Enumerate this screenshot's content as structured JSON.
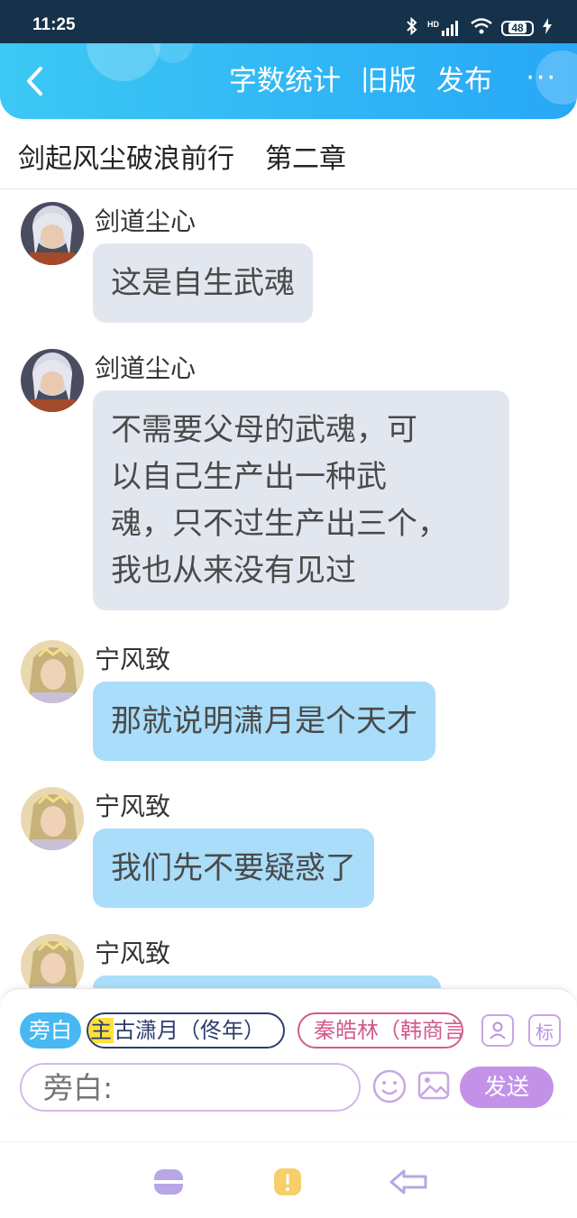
{
  "status_bar": {
    "time": "11:25",
    "battery": "48",
    "signal_label": "HD"
  },
  "header": {
    "actions": [
      "字数统计",
      "旧版",
      "发布"
    ],
    "more_label": "···",
    "colors": {
      "gradient_start": "#3cc8f4",
      "gradient_end": "#28a8f6"
    }
  },
  "title_bar": {
    "book_title": "剑起风尘破浪前行",
    "chapter": "第二章"
  },
  "messages": [
    {
      "name": "剑道尘心",
      "text": "这是自生武魂",
      "avatar": "silver-haired-avatar",
      "bubble": "grey"
    },
    {
      "name": "剑道尘心",
      "text": "不需要父母的武魂，可\n以自己生产出一种武\n魂，只不过生产出三个，\n我也从来没有见过",
      "avatar": "silver-haired-avatar",
      "bubble": "grey"
    },
    {
      "name": "宁风致",
      "text": "那就说明潇月是个天才",
      "avatar": "crowned-avatar",
      "bubble": "blue"
    },
    {
      "name": "宁风致",
      "text": "我们先不要疑惑了",
      "avatar": "crowned-avatar",
      "bubble": "blue"
    },
    {
      "name": "宁风致",
      "text": "",
      "avatar": "crowned-avatar",
      "bubble": "blue"
    }
  ],
  "compose": {
    "narration_chip": "旁白",
    "main_role_tag": "主",
    "main_role_name": "古潇月（佟年）",
    "other_role_name": "秦皓林（韩商言）",
    "tag_icon_label": "标",
    "input_placeholder": "旁白:",
    "send_label": "发送",
    "colors": {
      "narration": "#47b8f2",
      "main_role": "#2c3e6e",
      "other_role": "#d25a8c",
      "send": "#c392e8",
      "highlight": "#ffe13b"
    }
  },
  "bottom_nav": {
    "icons": [
      "menu-icon",
      "alert-icon",
      "back-arrow-icon"
    ]
  }
}
